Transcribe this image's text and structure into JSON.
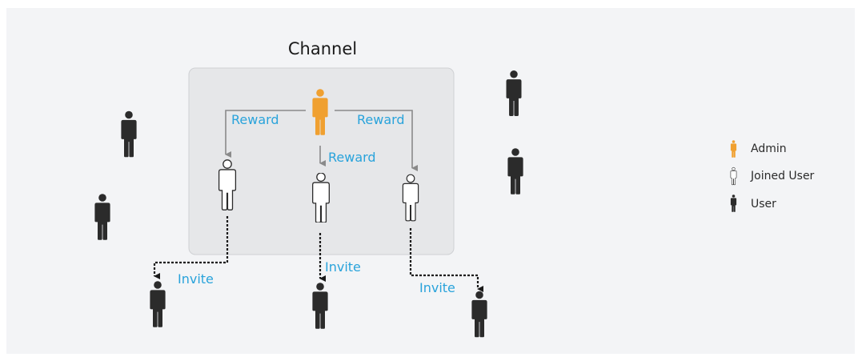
{
  "diagram": {
    "title": "Channel",
    "labels": {
      "reward_left": "Reward",
      "reward_center": "Reward",
      "reward_right": "Reward",
      "invite_left": "Invite",
      "invite_center": "Invite",
      "invite_right": "Invite"
    },
    "legend": [
      {
        "label": "Admin",
        "icon": "admin-icon"
      },
      {
        "label": "Joined User",
        "icon": "joined-user-icon"
      },
      {
        "label": "User",
        "icon": "user-icon"
      }
    ],
    "colors": {
      "admin": "#f0a030",
      "user": "#2b2b2b",
      "joined_user": "#ffffff",
      "label": "#29a3db",
      "channel_box": "#e6e7e9",
      "arrow": "#8a8a8a"
    }
  }
}
